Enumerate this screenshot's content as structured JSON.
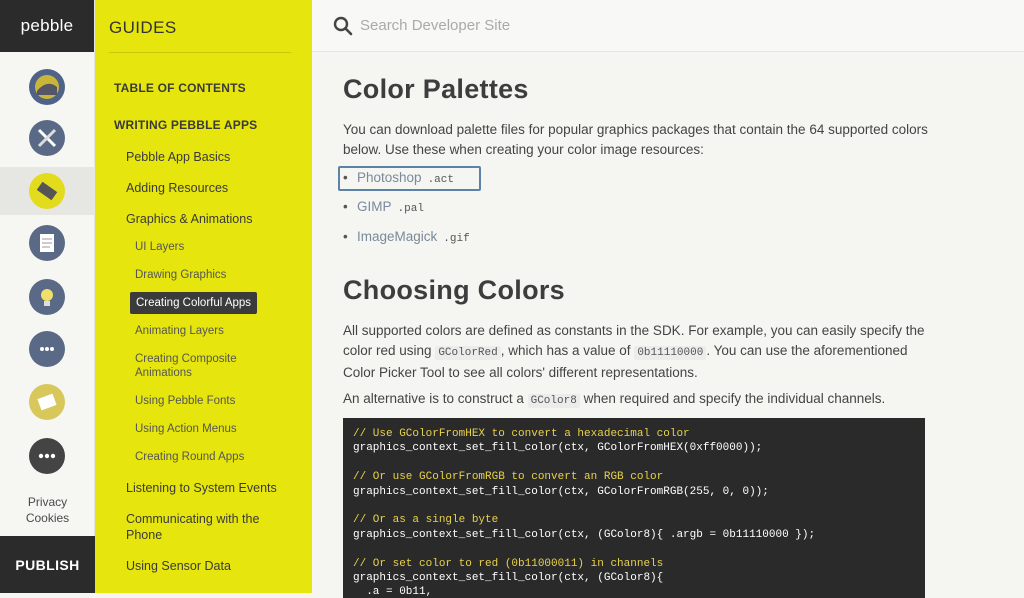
{
  "rail": {
    "brand": "pebble",
    "icons": [
      "watchface-icon",
      "tools-icon",
      "eraser-icon",
      "document-icon",
      "lightbulb-icon",
      "chat-icon",
      "envelope-icon",
      "more-icon"
    ],
    "privacy": "Privacy",
    "cookies": "Cookies",
    "publish": "PUBLISH"
  },
  "guides": {
    "title": "GUIDES",
    "items": [
      {
        "label": "TABLE OF CONTENTS",
        "kind": "sec"
      },
      {
        "label": "WRITING PEBBLE APPS",
        "kind": "sec"
      },
      {
        "label": "Pebble App Basics",
        "kind": "lvl1"
      },
      {
        "label": "Adding Resources",
        "kind": "lvl1"
      },
      {
        "label": "Graphics & Animations",
        "kind": "lvl1"
      },
      {
        "label": "UI Layers",
        "kind": "lvl2"
      },
      {
        "label": "Drawing Graphics",
        "kind": "lvl2"
      },
      {
        "label": "Creating Colorful Apps",
        "kind": "active"
      },
      {
        "label": "Animating Layers",
        "kind": "lvl2"
      },
      {
        "label": "Creating Composite",
        "kind": "lvl2"
      },
      {
        "label": "Animations",
        "kind": "lvl2"
      },
      {
        "label": "Using Pebble Fonts",
        "kind": "lvl2"
      },
      {
        "label": "Using Action Menus",
        "kind": "lvl2"
      },
      {
        "label": "Creating Round Apps",
        "kind": "lvl2"
      },
      {
        "label": "Listening to System Events",
        "kind": "lvl1"
      },
      {
        "label": "Communicating with the",
        "kind": "lvl1"
      },
      {
        "label": "Phone",
        "kind": "lvl1"
      },
      {
        "label": "Using Sensor Data",
        "kind": "lvl1"
      }
    ]
  },
  "search": {
    "placeholder": "Search Developer Site"
  },
  "content": {
    "h1": "Color Palettes",
    "intro": "You can download palette files for popular graphics packages that contain the 64 supported colors below. Use these when creating your color image resources:",
    "downloads": [
      {
        "label": "Photoshop",
        "ext": ".act"
      },
      {
        "label": "GIMP",
        "ext": ".pal"
      },
      {
        "label": "ImageMagick",
        "ext": ".gif"
      }
    ],
    "h2": "Choosing Colors",
    "p1_a": "All supported colors are defined as constants in the SDK. For example, you can easily specify the color red using ",
    "p1_code1": "GColorRed",
    "p1_b": ", which has a value of ",
    "p1_code2": "0b11110000",
    "p1_c": ". You can use the aforementioned Color Picker Tool to see all colors' different representations.",
    "p2_a": "An alternative is to construct a ",
    "p2_code": "GColor8",
    "p2_b": " when required and specify the individual channels.",
    "code_lines": [
      {
        "text": "// Use GColorFromHEX to convert a hexadecimal color",
        "comment": true
      },
      {
        "text": "graphics_context_set_fill_color(ctx, GColorFromHEX(0xff0000));",
        "comment": false
      },
      {
        "text": "",
        "comment": false
      },
      {
        "text": "// Or use GColorFromRGB to convert an RGB color",
        "comment": true
      },
      {
        "text": "graphics_context_set_fill_color(ctx, GColorFromRGB(255, 0, 0));",
        "comment": false
      },
      {
        "text": "",
        "comment": false
      },
      {
        "text": "// Or as a single byte",
        "comment": true
      },
      {
        "text": "graphics_context_set_fill_color(ctx, (GColor8){ .argb = 0b11110000 });",
        "comment": false
      },
      {
        "text": "",
        "comment": false
      },
      {
        "text": "// Or set color to red (0b11000011) in channels",
        "comment": true
      },
      {
        "text": "graphics_context_set_fill_color(ctx, (GColor8){",
        "comment": false
      },
      {
        "text": "  .a = 0b11,",
        "comment": false
      }
    ]
  }
}
